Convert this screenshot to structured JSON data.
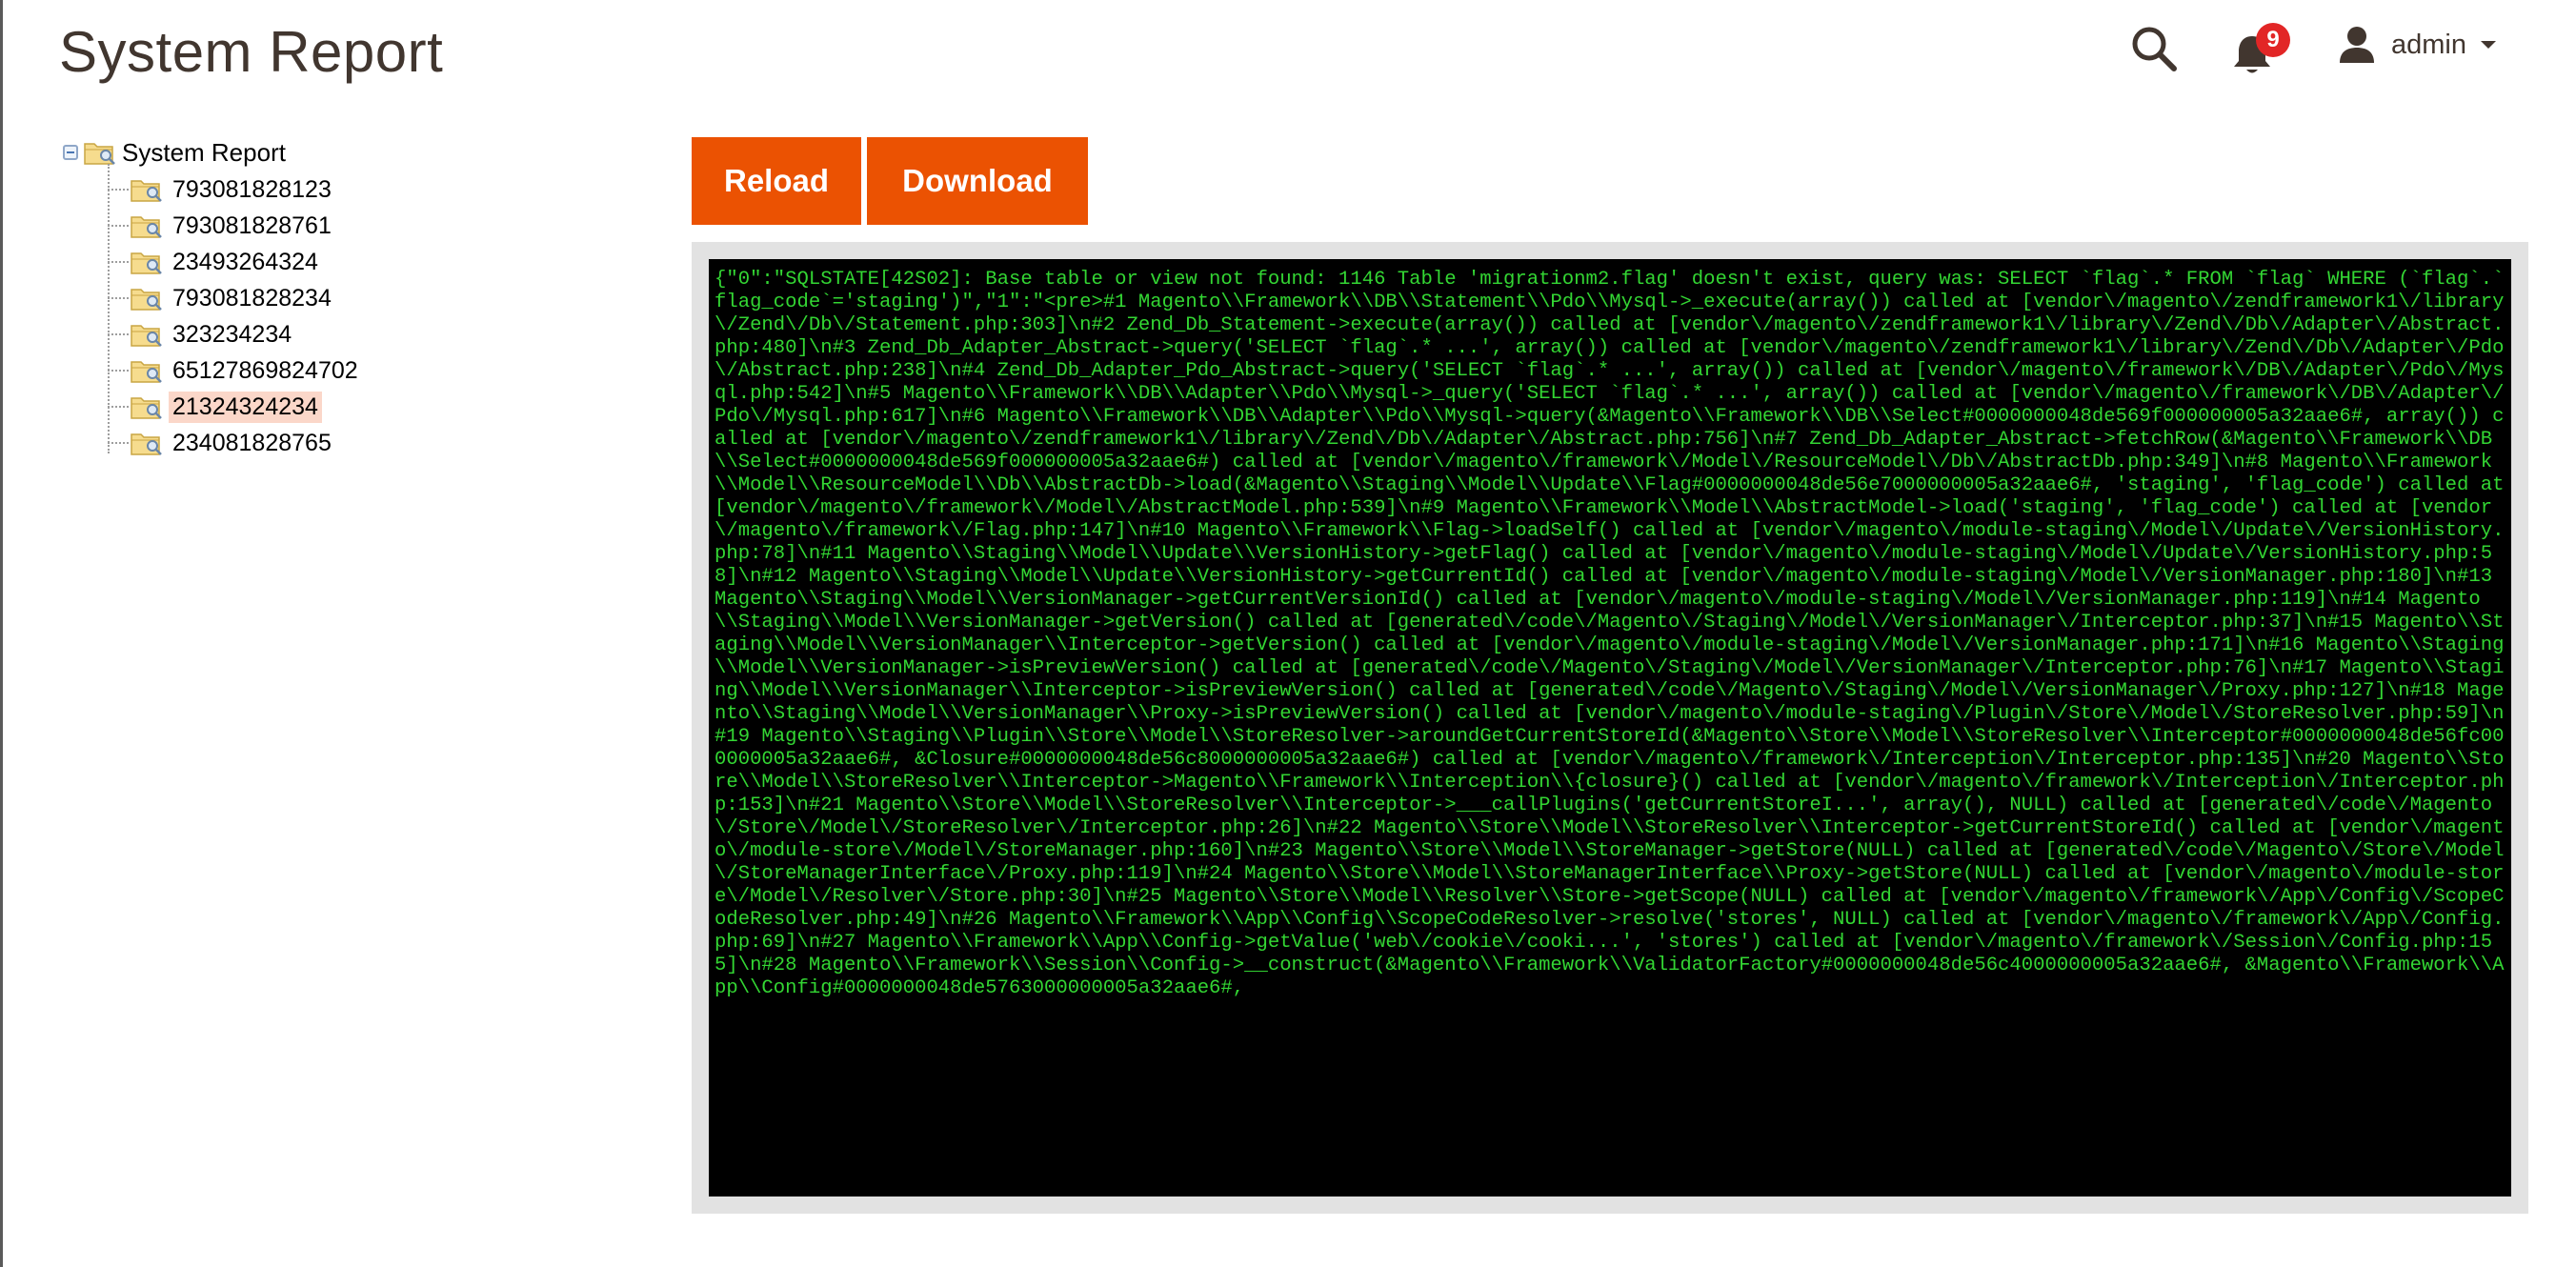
{
  "page": {
    "title": "System Report"
  },
  "header": {
    "search_icon": "search-icon",
    "notifications": {
      "icon": "bell-icon",
      "count": "9"
    },
    "user": {
      "icon": "user-icon",
      "name": "admin"
    }
  },
  "tree": {
    "root_label": "System Report",
    "items": [
      {
        "label": "793081828123"
      },
      {
        "label": "793081828761"
      },
      {
        "label": "23493264324"
      },
      {
        "label": "793081828234"
      },
      {
        "label": "323234234"
      },
      {
        "label": "65127869824702"
      },
      {
        "label": "21324324234",
        "selected": true
      },
      {
        "label": "234081828765"
      }
    ]
  },
  "toolbar": {
    "reload_label": "Reload",
    "download_label": "Download"
  },
  "log": {
    "text": "{\"0\":\"SQLSTATE[42S02]: Base table or view not found: 1146 Table 'migrationm2.flag' doesn't exist, query was: SELECT `flag`.* FROM `flag` WHERE (`flag`.`flag_code`='staging')\",\"1\":\"<pre>#1 Magento\\\\Framework\\\\DB\\\\Statement\\\\Pdo\\\\Mysql->_execute(array()) called at [vendor\\/magento\\/zendframework1\\/library\\/Zend\\/Db\\/Statement.php:303]\\n#2 Zend_Db_Statement->execute(array()) called at [vendor\\/magento\\/zendframework1\\/library\\/Zend\\/Db\\/Adapter\\/Abstract.php:480]\\n#3 Zend_Db_Adapter_Abstract->query('SELECT `flag`.* ...', array()) called at [vendor\\/magento\\/zendframework1\\/library\\/Zend\\/Db\\/Adapter\\/Pdo\\/Abstract.php:238]\\n#4 Zend_Db_Adapter_Pdo_Abstract->query('SELECT `flag`.* ...', array()) called at [vendor\\/magento\\/framework\\/DB\\/Adapter\\/Pdo\\/Mysql.php:542]\\n#5 Magento\\\\Framework\\\\DB\\\\Adapter\\\\Pdo\\\\Mysql->_query('SELECT `flag`.* ...', array()) called at [vendor\\/magento\\/framework\\/DB\\/Adapter\\/Pdo\\/Mysql.php:617]\\n#6 Magento\\\\Framework\\\\DB\\\\Adapter\\\\Pdo\\\\Mysql->query(&Magento\\\\Framework\\\\DB\\\\Select#0000000048de569f000000005a32aae6#, array()) called at [vendor\\/magento\\/zendframework1\\/library\\/Zend\\/Db\\/Adapter\\/Abstract.php:756]\\n#7 Zend_Db_Adapter_Abstract->fetchRow(&Magento\\\\Framework\\\\DB\\\\Select#0000000048de569f000000005a32aae6#) called at [vendor\\/magento\\/framework\\/Model\\/ResourceModel\\/Db\\/AbstractDb.php:349]\\n#8 Magento\\\\Framework\\\\Model\\\\ResourceModel\\\\Db\\\\AbstractDb->load(&Magento\\\\Staging\\\\Model\\\\Update\\\\Flag#0000000048de56e7000000005a32aae6#, 'staging', 'flag_code') called at [vendor\\/magento\\/framework\\/Model\\/AbstractModel.php:539]\\n#9 Magento\\\\Framework\\\\Model\\\\AbstractModel->load('staging', 'flag_code') called at [vendor\\/magento\\/framework\\/Flag.php:147]\\n#10 Magento\\\\Framework\\\\Flag->loadSelf() called at [vendor\\/magento\\/module-staging\\/Model\\/Update\\/VersionHistory.php:78]\\n#11 Magento\\\\Staging\\\\Model\\\\Update\\\\VersionHistory->getFlag() called at [vendor\\/magento\\/module-staging\\/Model\\/Update\\/VersionHistory.php:58]\\n#12 Magento\\\\Staging\\\\Model\\\\Update\\\\VersionHistory->getCurrentId() called at [vendor\\/magento\\/module-staging\\/Model\\/VersionManager.php:180]\\n#13 Magento\\\\Staging\\\\Model\\\\VersionManager->getCurrentVersionId() called at [vendor\\/magento\\/module-staging\\/Model\\/VersionManager.php:119]\\n#14 Magento\\\\Staging\\\\Model\\\\VersionManager->getVersion() called at [generated\\/code\\/Magento\\/Staging\\/Model\\/VersionManager\\/Interceptor.php:37]\\n#15 Magento\\\\Staging\\\\Model\\\\VersionManager\\\\Interceptor->getVersion() called at [vendor\\/magento\\/module-staging\\/Model\\/VersionManager.php:171]\\n#16 Magento\\\\Staging\\\\Model\\\\VersionManager->isPreviewVersion() called at [generated\\/code\\/Magento\\/Staging\\/Model\\/VersionManager\\/Interceptor.php:76]\\n#17 Magento\\\\Staging\\\\Model\\\\VersionManager\\\\Interceptor->isPreviewVersion() called at [generated\\/code\\/Magento\\/Staging\\/Model\\/VersionManager\\/Proxy.php:127]\\n#18 Magento\\\\Staging\\\\Model\\\\VersionManager\\\\Proxy->isPreviewVersion() called at [vendor\\/magento\\/module-staging\\/Plugin\\/Store\\/Model\\/StoreResolver.php:59]\\n#19 Magento\\\\Staging\\\\Plugin\\\\Store\\\\Model\\\\StoreResolver->aroundGetCurrentStoreId(&Magento\\\\Store\\\\Model\\\\StoreResolver\\\\Interceptor#0000000048de56fc000000005a32aae6#, &Closure#0000000048de56c8000000005a32aae6#) called at [vendor\\/magento\\/framework\\/Interception\\/Interceptor.php:135]\\n#20 Magento\\\\Store\\\\Model\\\\StoreResolver\\\\Interceptor->Magento\\\\Framework\\\\Interception\\\\{closure}() called at [vendor\\/magento\\/framework\\/Interception\\/Interceptor.php:153]\\n#21 Magento\\\\Store\\\\Model\\\\StoreResolver\\\\Interceptor->___callPlugins('getCurrentStoreI...', array(), NULL) called at [generated\\/code\\/Magento\\/Store\\/Model\\/StoreResolver\\/Interceptor.php:26]\\n#22 Magento\\\\Store\\\\Model\\\\StoreResolver\\\\Interceptor->getCurrentStoreId() called at [vendor\\/magento\\/module-store\\/Model\\/StoreManager.php:160]\\n#23 Magento\\\\Store\\\\Model\\\\StoreManager->getStore(NULL) called at [generated\\/code\\/Magento\\/Store\\/Model\\/StoreManagerInterface\\/Proxy.php:119]\\n#24 Magento\\\\Store\\\\Model\\\\StoreManagerInterface\\\\Proxy->getStore(NULL) called at [vendor\\/magento\\/module-store\\/Model\\/Resolver\\/Store.php:30]\\n#25 Magento\\\\Store\\\\Model\\\\Resolver\\\\Store->getScope(NULL) called at [vendor\\/magento\\/framework\\/App\\/Config\\/ScopeCodeResolver.php:49]\\n#26 Magento\\\\Framework\\\\App\\\\Config\\\\ScopeCodeResolver->resolve('stores', NULL) called at [vendor\\/magento\\/framework\\/App\\/Config.php:69]\\n#27 Magento\\\\Framework\\\\App\\\\Config->getValue('web\\/cookie\\/cooki...', 'stores') called at [vendor\\/magento\\/framework\\/Session\\/Config.php:155]\\n#28 Magento\\\\Framework\\\\Session\\\\Config->__construct(&Magento\\\\Framework\\\\ValidatorFactory#0000000048de56c4000000005a32aae6#, &Magento\\\\Framework\\\\App\\\\Config#0000000048de5763000000005a32aae6#,"
  }
}
